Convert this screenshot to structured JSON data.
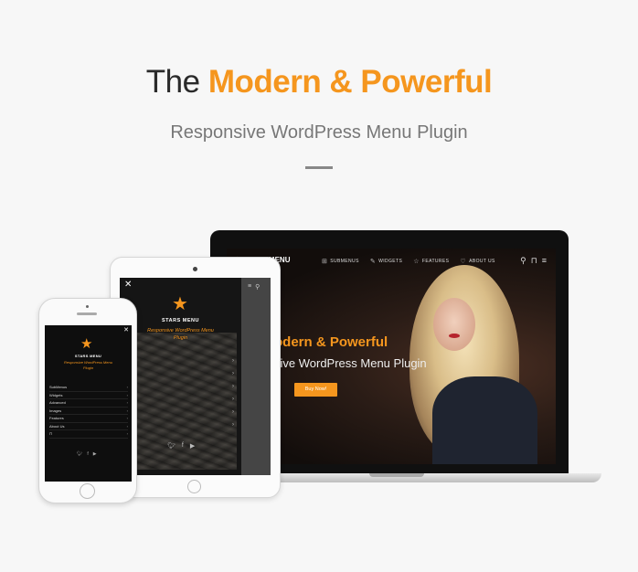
{
  "hero": {
    "title_prefix": "The",
    "title_accent": "Modern & Powerful",
    "subtitle": "Responsive WordPress Menu Plugin"
  },
  "colors": {
    "accent": "#f5961e",
    "background": "#f7f7f7"
  },
  "laptop": {
    "logo": "STARS MENU",
    "menu": [
      {
        "label": "SUBMENUS",
        "icon": "grid-icon"
      },
      {
        "label": "WIDGETS",
        "icon": "pencil-icon"
      },
      {
        "label": "FEATURES",
        "icon": "star-icon"
      },
      {
        "label": "ABOUT US",
        "icon": "heart-icon"
      }
    ],
    "tools": [
      "search-icon",
      "bag-icon",
      "hamburger-icon"
    ],
    "headline": "odern & Powerful",
    "subline": "sive WordPress Menu Plugin",
    "button": "Buy Now!"
  },
  "tablet": {
    "brand": "STARS MENU",
    "tagline_1": "Responsive WordPress Menu",
    "tagline_2": "Plugin"
  },
  "phone": {
    "brand": "STARS MENU",
    "tagline_1": "Responsive WordPress Menu",
    "tagline_2": "Plugin",
    "menu": [
      "SubMenus",
      "Widgets",
      "Advanced",
      "Images",
      "Features",
      "About Us"
    ]
  }
}
